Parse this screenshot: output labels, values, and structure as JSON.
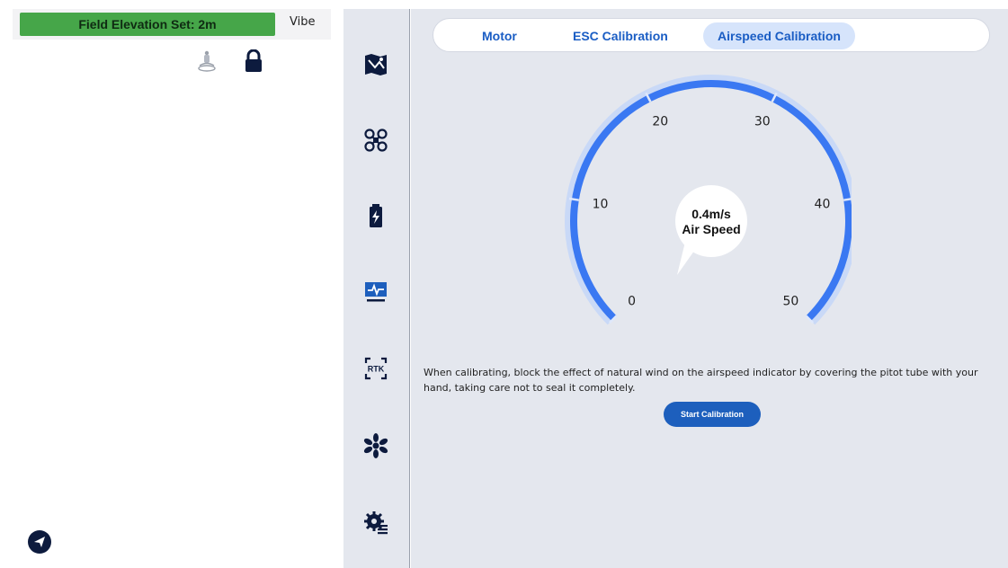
{
  "left_panel": {
    "elevation_label": "Field Elevation Set: 2m",
    "vibe_label": "Vibe",
    "icons": [
      "drone-icon",
      "lock-icon",
      "send-icon"
    ]
  },
  "nav": {
    "items": [
      {
        "icon": "map-icon"
      },
      {
        "icon": "drone-icon"
      },
      {
        "icon": "battery-icon"
      },
      {
        "icon": "monitor-icon"
      },
      {
        "icon": "rtk-icon",
        "label": "RTK"
      },
      {
        "icon": "propeller-icon"
      },
      {
        "icon": "settings-icon"
      }
    ]
  },
  "tabs": [
    {
      "label": "Motor",
      "active": false
    },
    {
      "label": "ESC Calibration",
      "active": false
    },
    {
      "label": "Airspeed Calibration",
      "active": true
    }
  ],
  "gauge": {
    "value": "0.4m/s",
    "caption": "Air Speed",
    "ticks": [
      "0",
      "10",
      "20",
      "30",
      "40",
      "50"
    ],
    "min": 0,
    "max": 50,
    "current": 0.4,
    "accent": "#3a78f2",
    "halo": "#c9d9f7"
  },
  "instruction": "When calibrating, block the effect of natural wind on the airspeed indicator by covering the pitot tube with your hand, taking care not to seal it completely.",
  "start_button": "Start Calibration",
  "colors": {
    "elevation_bar": "#46a649",
    "primary": "#1d5fbd",
    "nav_icon": "#0d1b3e",
    "panel_bg": "#e4e7ee"
  }
}
